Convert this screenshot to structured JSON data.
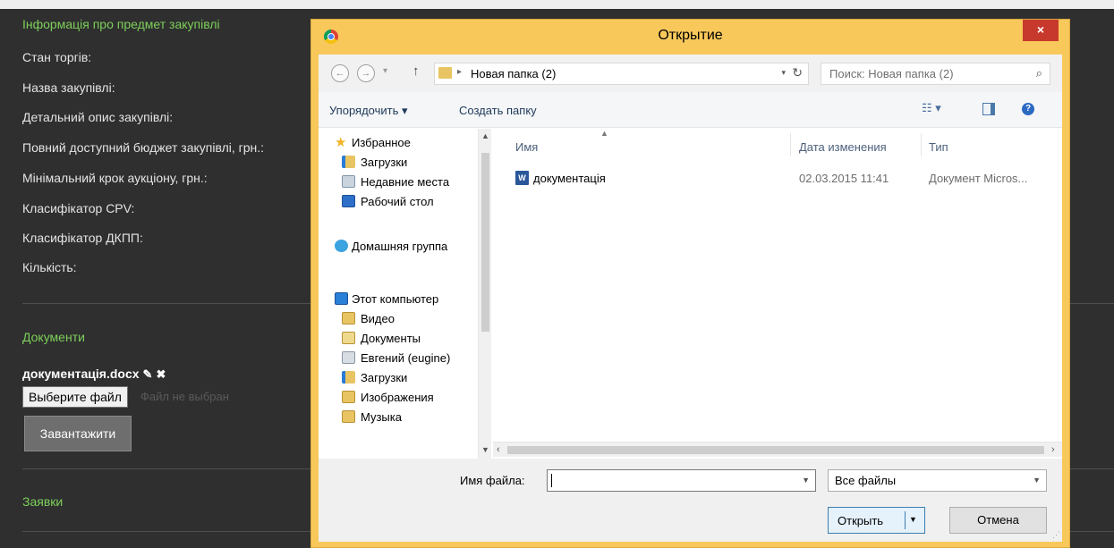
{
  "page": {
    "section_info": "Інформація про предмет закупівлі",
    "fields": [
      "Стан торгів:",
      "Назва закупівлі:",
      "Детальний опис закупівлі:",
      "Повний доступний бюджет закупівлі, грн.:",
      "Мінімальний крок аукціону, грн.:",
      "Класифікатор CPV:",
      "Класифікатор ДКПП:",
      "Кількість:"
    ],
    "section_docs": "Документи",
    "doc_name": "документація.docx",
    "edit_icon": "✎",
    "delete_icon": "✖",
    "choose_file_label": "Выберите файл",
    "no_file_text": "Файл не выбран",
    "upload_label": "Завантажити",
    "section_bids": "Заявки"
  },
  "dialog": {
    "title": "Открытие",
    "close_label": "×",
    "back_glyph": "←",
    "forward_glyph": "→",
    "up_glyph": "↑",
    "breadcrumb_sep": "▸",
    "path": "Новая папка (2)",
    "refresh_glyph": "↻",
    "search_placeholder": "Поиск: Новая папка (2)",
    "search_glyph": "⌕",
    "organize_label": "Упорядочить ▾",
    "new_folder_label": "Создать папку",
    "views_glyph": "☷ ▾",
    "help_glyph": "?",
    "nav_items": [
      "Избранное",
      "Загрузки",
      "Недавние места",
      "Рабочий стол",
      "Домашняя группа",
      "Этот компьютер",
      "Видео",
      "Документы",
      "Евгений (eugine)",
      "Загрузки",
      "Изображения",
      "Музыка"
    ],
    "columns": [
      "Имя",
      "Дата изменения",
      "Тип"
    ],
    "files": [
      {
        "name": "документація",
        "date": "02.03.2015 11:41",
        "type": "Документ Micros...",
        "icon": "W"
      }
    ],
    "filename_label": "Имя файла:",
    "filename_value": "",
    "filter_value": "Все файлы",
    "open_label": "Открыть",
    "cancel_label": "Отмена"
  },
  "colors": {
    "page_bg": "#2f2f2f",
    "accent_green": "#7dcf5a",
    "dialog_frame": "#f8c85a",
    "close_red": "#c7392c"
  }
}
